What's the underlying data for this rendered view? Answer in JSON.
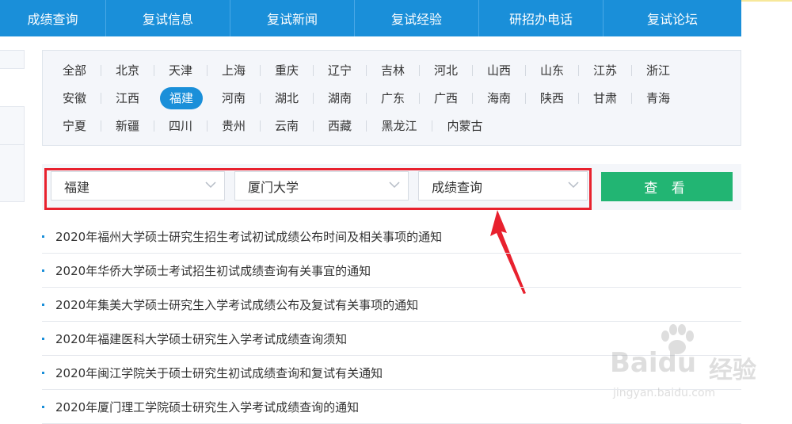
{
  "nav": {
    "items": [
      "成绩查询",
      "复试信息",
      "复试新闻",
      "复试经验",
      "研招办电话",
      "复试论坛"
    ]
  },
  "regions": {
    "rows": [
      [
        "全部",
        "北京",
        "天津",
        "上海",
        "重庆",
        "辽宁",
        "吉林",
        "河北",
        "山西",
        "山东",
        "江苏",
        "浙江"
      ],
      [
        "安徽",
        "江西",
        "福建",
        "河南",
        "湖北",
        "湖南",
        "广东",
        "广西",
        "海南",
        "陕西",
        "甘肃",
        "青海"
      ],
      [
        "宁夏",
        "新疆",
        "四川",
        "贵州",
        "云南",
        "西藏",
        "黑龙江",
        "内蒙古"
      ]
    ],
    "selected": "福建"
  },
  "filters": {
    "province": "福建",
    "school": "厦门大学",
    "category": "成绩查询",
    "view_label": "查 看"
  },
  "news": [
    "2020年福州大学硕士研究生招生考试初试成绩公布时间及相关事项的通知",
    "2020年华侨大学硕士考试招生初试成绩查询有关事宜的通知",
    "2020年集美大学硕士研究生入学考试成绩公布及复试有关事项的通知",
    "2020年福建医科大学硕士研究生入学考试成绩查询须知",
    "2020年闽江学院关于硕士研究生初试成绩查询和复试有关通知",
    "2020年厦门理工学院硕士研究生入学考试成绩查询的通知"
  ],
  "watermark": {
    "logo": "Baidu",
    "brand": "经验",
    "url": "jingyan.baidu.com"
  },
  "colors": {
    "nav_bg": "#1a8fd9",
    "active_region": "#1a8fd9",
    "view_button": "#22b573",
    "highlight_frame": "#e8212e"
  }
}
